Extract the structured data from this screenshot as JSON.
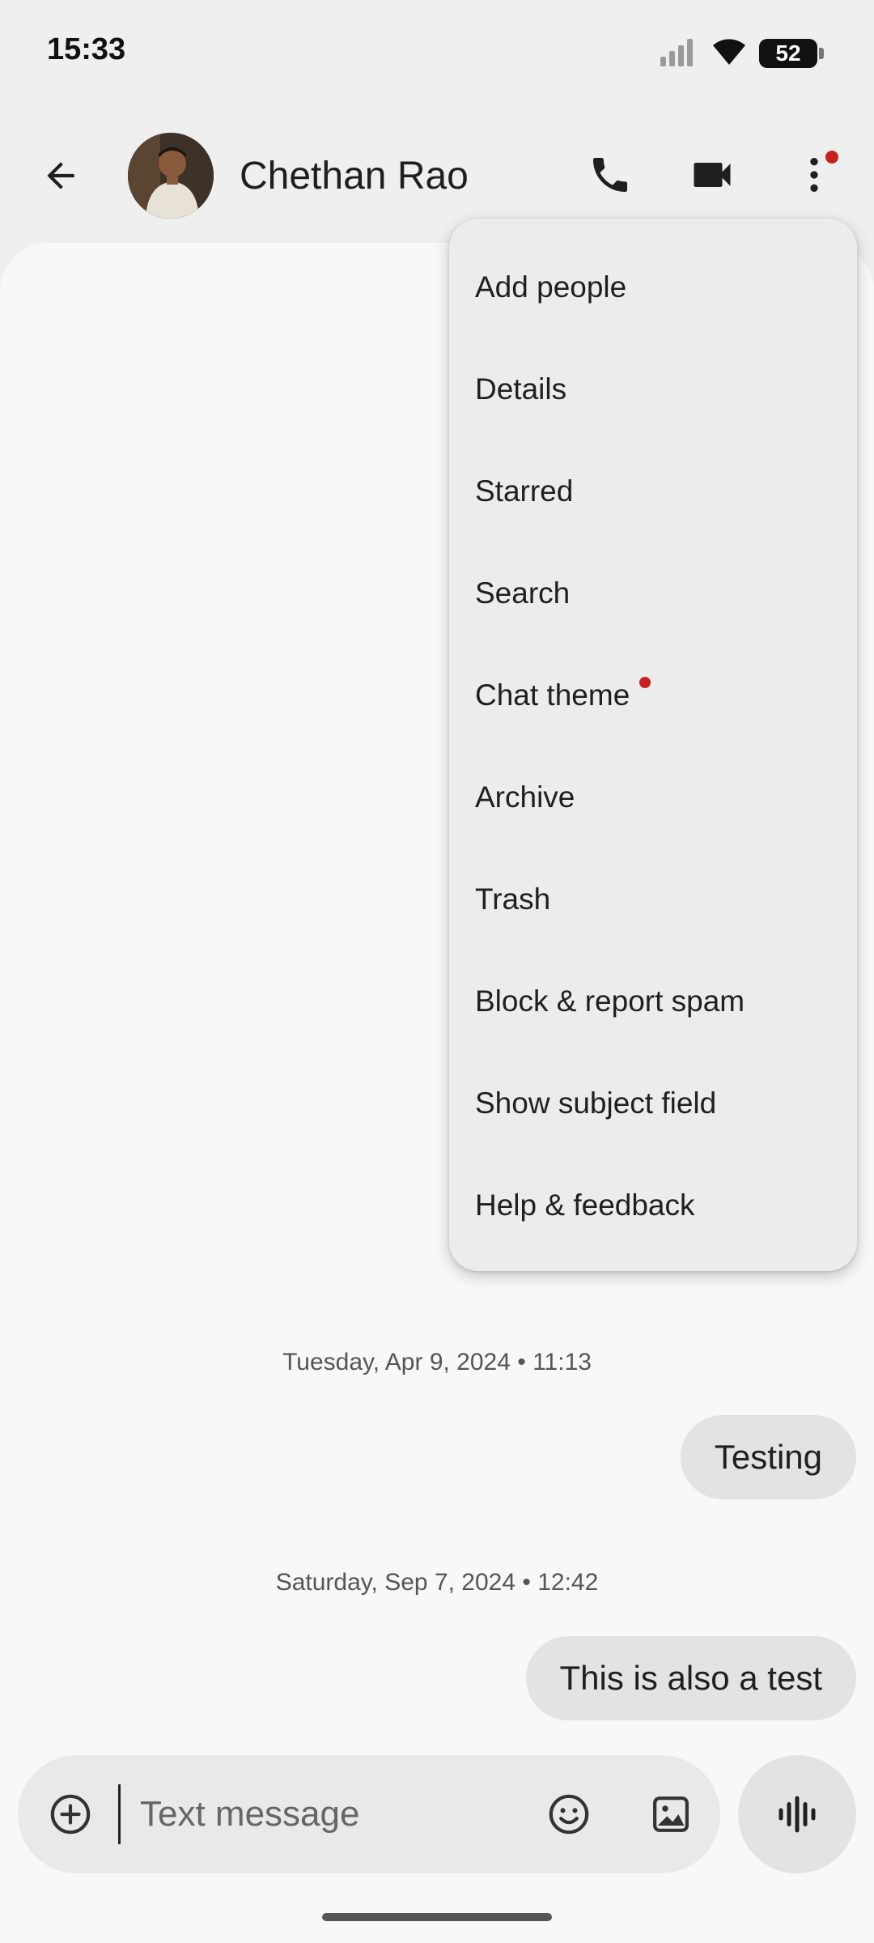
{
  "status_bar": {
    "time": "15:33",
    "battery": "52"
  },
  "header": {
    "contact_name": "Chethan Rao",
    "icons": [
      "back-arrow-icon",
      "phone-icon",
      "video-camera-icon",
      "more-vert-icon"
    ],
    "notification_dot_color": "#c5221f"
  },
  "menu": {
    "items": [
      {
        "label": "Add people"
      },
      {
        "label": "Details"
      },
      {
        "label": "Starred"
      },
      {
        "label": "Search"
      },
      {
        "label": "Chat theme",
        "badge": true
      },
      {
        "label": "Archive"
      },
      {
        "label": "Trash"
      },
      {
        "label": "Block & report spam"
      },
      {
        "label": "Show subject field"
      },
      {
        "label": "Help & feedback"
      }
    ]
  },
  "messages": [
    {
      "timestamp": "Tuesday, Apr 9, 2024 • 11:13",
      "text": "Testing"
    },
    {
      "timestamp": "Saturday, Sep 7, 2024 • 12:42",
      "text": "This is also a test"
    }
  ],
  "compose": {
    "placeholder": "Text message",
    "icons": [
      "add-circle-icon",
      "emoji-icon",
      "image-icon",
      "voice-waveform-icon"
    ]
  },
  "colors": {
    "background": "#efefef",
    "conversation_bg": "#f8f8f8",
    "bubble_bg": "#e3e3e3",
    "menu_bg": "#ececec",
    "accent_red": "#c5221f"
  }
}
